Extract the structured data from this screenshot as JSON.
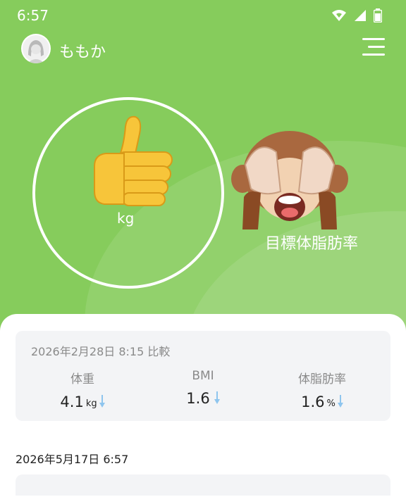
{
  "status_bar": {
    "time": "6:57",
    "icons": [
      "wifi-icon",
      "signal-icon",
      "battery-icon"
    ]
  },
  "header": {
    "user_name": "ももか",
    "avatar": "avatar-icon",
    "menu": "menu-icon"
  },
  "hero": {
    "weight_unit": "kg",
    "target_label": "目標体脂肪率",
    "emojis": [
      "thumbs-up-icon",
      "see-no-evil-monkey-icon"
    ]
  },
  "comparison": {
    "title": "2026年2月28日 8:15 比較",
    "metrics": [
      {
        "label": "体重",
        "value": "4.1",
        "unit": "kg",
        "trend": "down"
      },
      {
        "label": "BMI",
        "value": "1.6",
        "unit": "",
        "trend": "down"
      },
      {
        "label": "体脂肪率",
        "value": "1.6",
        "unit": "%",
        "trend": "down"
      }
    ]
  },
  "record": {
    "date": "2026年5月17日 6:57"
  },
  "colors": {
    "background_green": "#86cc5c",
    "arrow_blue": "#8ec5ee",
    "card_grey": "#f3f4f6",
    "muted_text": "#8a8a8a"
  }
}
